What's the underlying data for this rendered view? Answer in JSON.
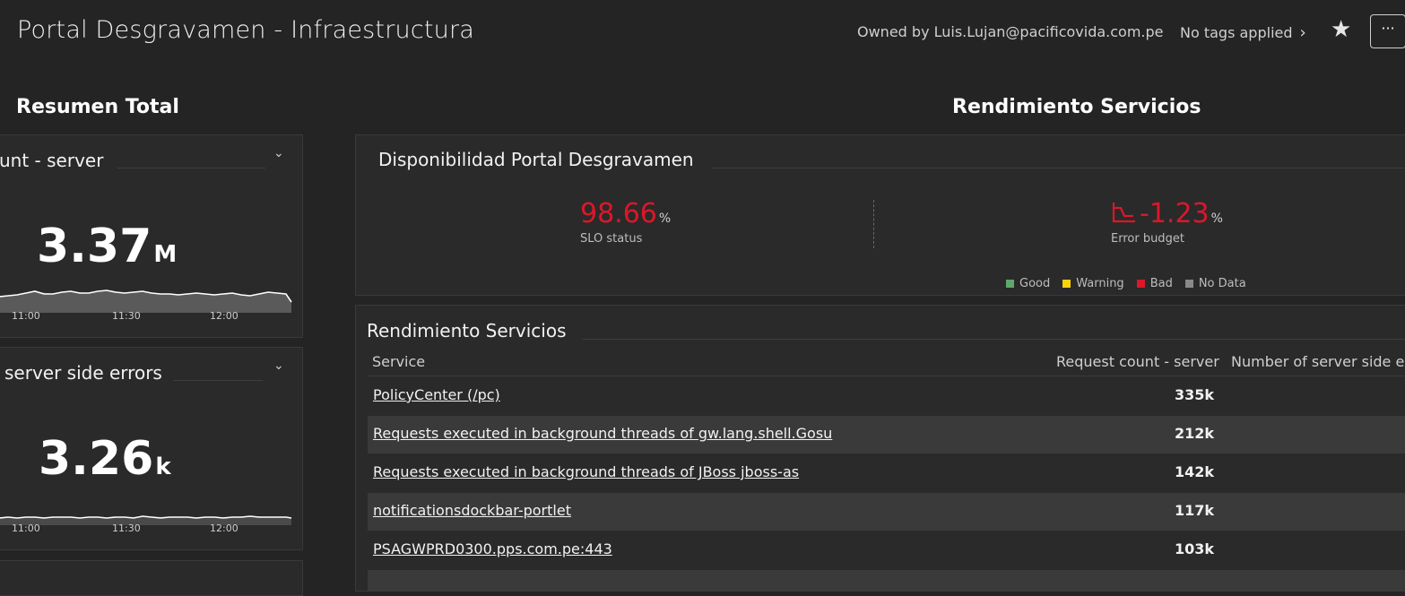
{
  "header": {
    "title": "Portal Desgravamen - Infraestructura",
    "owner": "Owned by Luis.Lujan@pacificovida.com.pe",
    "tags": "No tags applied",
    "star_icon": "star-icon",
    "more_label": "···"
  },
  "sections": {
    "left_title": "Resumen Total",
    "right_title": "Rendimiento Servicios"
  },
  "tiles": {
    "request_count": {
      "title": "unt - server",
      "value": "3.37",
      "unit": "M",
      "x_ticks": [
        "11:00",
        "11:30",
        "12:00"
      ]
    },
    "server_errors": {
      "title": "server side errors",
      "value": "3.26",
      "unit": "k",
      "x_ticks": [
        "11:00",
        "11:30",
        "12:00"
      ]
    }
  },
  "slo": {
    "title": "Disponibilidad Portal Desgravamen",
    "status_value": "98.66",
    "status_unit": "%",
    "status_label": "SLO status",
    "budget_value": "-1.23",
    "budget_unit": "%",
    "budget_label": "Error budget",
    "legend": [
      {
        "label": "Good",
        "color": "#5ea86b"
      },
      {
        "label": "Warning",
        "color": "#f5d30f"
      },
      {
        "label": "Bad",
        "color": "#dc172a"
      },
      {
        "label": "No Data",
        "color": "#898989"
      }
    ]
  },
  "services_table": {
    "title": "Rendimiento Servicios",
    "columns": [
      "Service",
      "Request count - server",
      "Number of server side er"
    ],
    "rows": [
      {
        "service": "PolicyCenter (/pc)",
        "count": "335k"
      },
      {
        "service": "Requests executed in background threads of gw.lang.shell.Gosu",
        "count": "212k"
      },
      {
        "service": "Requests executed in background threads of JBoss jboss-as",
        "count": "142k"
      },
      {
        "service": "notificationsdockbar-portlet",
        "count": "117k"
      },
      {
        "service": "PSAGWPRD0300.pps.com.pe:443",
        "count": "103k"
      }
    ]
  },
  "colors": {
    "background": "#242424",
    "tile": "#2a2a2a",
    "bad_red": "#dc172a",
    "alt_row": "#3a3a3a"
  }
}
